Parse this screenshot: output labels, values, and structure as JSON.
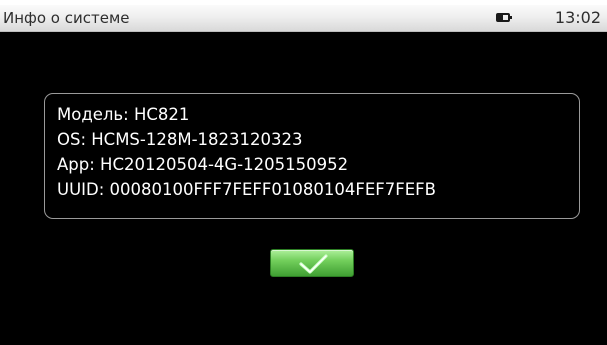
{
  "status_bar": {
    "title": "Инфо о системе",
    "battery_icon": "battery-icon",
    "time": "13:02"
  },
  "info_panel": {
    "lines": [
      "Модель:  HC821",
      "OS:  HCMS-128M-1823120323",
      "App:  HC20120504-4G-1205150952",
      "UUID: 00080100FFF7FEFF01080104FEF7FEFB"
    ]
  },
  "ok_button": {
    "icon": "checkmark-icon",
    "colors": {
      "top": "#aef09b",
      "bottom": "#3f9f32"
    }
  },
  "colors": {
    "content_background": "#000000",
    "text": "#ffffff",
    "panel_border": "#9a9a9a",
    "status_bar_text": "#2e2e2e"
  }
}
